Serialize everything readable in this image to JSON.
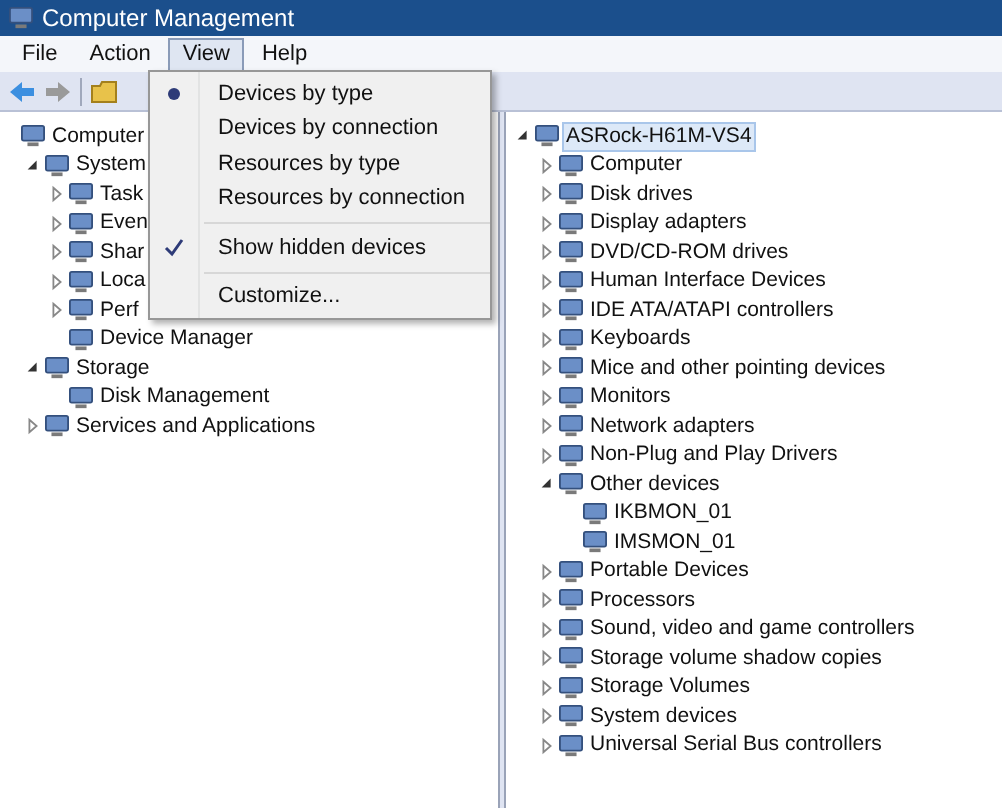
{
  "window": {
    "title": "Computer Management"
  },
  "menu": [
    {
      "label": "File",
      "selected": false
    },
    {
      "label": "Action",
      "selected": false
    },
    {
      "label": "View",
      "selected": true
    },
    {
      "label": "Help",
      "selected": false
    }
  ],
  "view_menu": [
    {
      "kind": "radio",
      "label": "Devices by type",
      "checked": true
    },
    {
      "kind": "radio",
      "label": "Devices by connection",
      "checked": false
    },
    {
      "kind": "radio",
      "label": "Resources by type",
      "checked": false
    },
    {
      "kind": "radio",
      "label": "Resources by connection",
      "checked": false
    },
    {
      "kind": "separator"
    },
    {
      "kind": "check",
      "label": "Show hidden devices",
      "checked": true
    },
    {
      "kind": "separator"
    },
    {
      "kind": "plain",
      "label": "Customize..."
    }
  ],
  "left_tree": [
    {
      "label": "Computer",
      "children": [
        {
          "label": "System",
          "expanded": true,
          "children": [
            {
              "label": "Task",
              "expanded": false
            },
            {
              "label": "Even",
              "expanded": false
            },
            {
              "label": "Shar",
              "expanded": false
            },
            {
              "label": "Loca",
              "expanded": false
            },
            {
              "label": "Perf",
              "expanded": false
            },
            {
              "label": "Device Manager"
            }
          ]
        },
        {
          "label": "Storage",
          "expanded": true,
          "children": [
            {
              "label": "Disk Management"
            }
          ]
        },
        {
          "label": "Services and Applications",
          "expanded": false
        }
      ]
    }
  ],
  "right_tree": [
    {
      "label": "ASRock-H61M-VS4",
      "expanded": true,
      "selected": true,
      "children": [
        {
          "label": "Computer",
          "expanded": false,
          "selected": false
        },
        {
          "label": "Disk drives",
          "expanded": false,
          "selected": false
        },
        {
          "label": "Display adapters",
          "expanded": false,
          "selected": false
        },
        {
          "label": "DVD/CD-ROM drives",
          "expanded": false,
          "selected": false
        },
        {
          "label": "Human Interface Devices",
          "expanded": false,
          "selected": false
        },
        {
          "label": "IDE ATA/ATAPI controllers",
          "expanded": false,
          "selected": false
        },
        {
          "label": "Keyboards",
          "expanded": false,
          "selected": false
        },
        {
          "label": "Mice and other pointing devices",
          "expanded": false,
          "selected": false
        },
        {
          "label": "Monitors",
          "expanded": false,
          "selected": false
        },
        {
          "label": "Network adapters",
          "expanded": false,
          "selected": false
        },
        {
          "label": "Non-Plug and Play Drivers",
          "expanded": false,
          "selected": false
        },
        {
          "label": "Other devices",
          "expanded": true,
          "selected": false,
          "children": [
            {
              "label": "IKBMON_01",
              "selected": false
            },
            {
              "label": "IMSMON_01",
              "selected": false
            }
          ]
        },
        {
          "label": "Portable Devices",
          "expanded": false,
          "selected": false
        },
        {
          "label": "Processors",
          "expanded": false,
          "selected": false
        },
        {
          "label": "Sound, video and game controllers",
          "expanded": false,
          "selected": false
        },
        {
          "label": "Storage volume shadow copies",
          "expanded": false,
          "selected": false
        },
        {
          "label": "Storage Volumes",
          "expanded": false,
          "selected": false
        },
        {
          "label": "System devices",
          "expanded": false,
          "selected": false
        },
        {
          "label": "Universal Serial Bus controllers",
          "expanded": false,
          "selected": false
        }
      ]
    }
  ]
}
